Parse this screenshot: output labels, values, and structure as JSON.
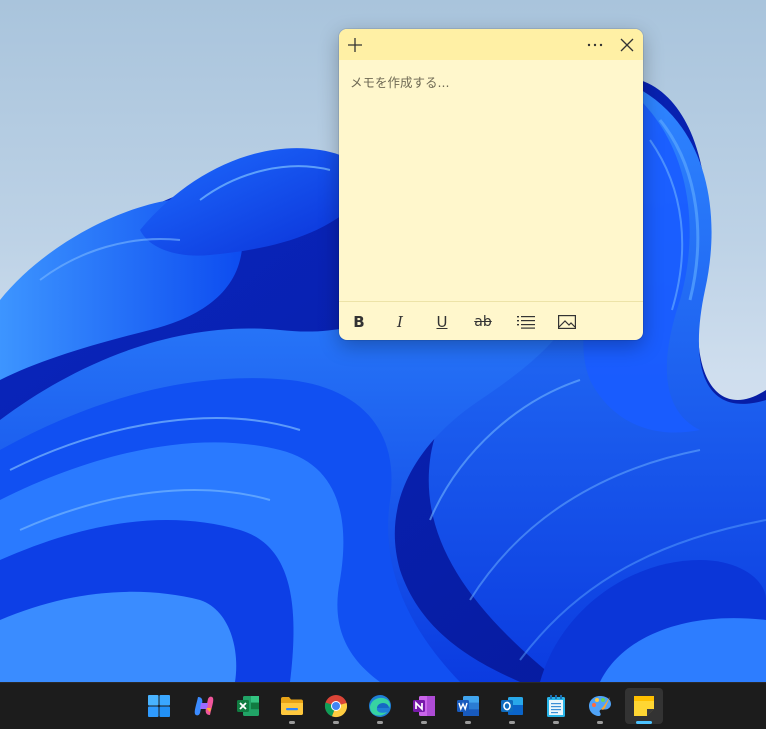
{
  "note": {
    "placeholder": "メモを作成する...",
    "header_buttons": [
      "add-icon",
      "more-icon",
      "close-icon"
    ],
    "toolbar": [
      "bold",
      "italic",
      "underline",
      "strikethrough",
      "bulleted-list",
      "image"
    ],
    "colors": {
      "header": "#fff0a5",
      "body": "#fff7cc"
    }
  },
  "taskbar": {
    "apps": [
      {
        "name": "start-icon",
        "running": false
      },
      {
        "name": "copilot-icon",
        "running": false
      },
      {
        "name": "excel-icon",
        "running": false
      },
      {
        "name": "file-explorer-icon",
        "running": true
      },
      {
        "name": "chrome-icon",
        "running": true
      },
      {
        "name": "edge-icon",
        "running": true
      },
      {
        "name": "onenote-icon",
        "running": true
      },
      {
        "name": "word-icon",
        "running": true
      },
      {
        "name": "outlook-icon",
        "running": true
      },
      {
        "name": "notepad-icon",
        "running": true
      },
      {
        "name": "paint-icon",
        "running": true
      },
      {
        "name": "sticky-notes-icon",
        "running": true,
        "active": true
      }
    ],
    "colors": {
      "background": "#1c1c1c",
      "active_indicator": "#4cc2ff"
    }
  }
}
